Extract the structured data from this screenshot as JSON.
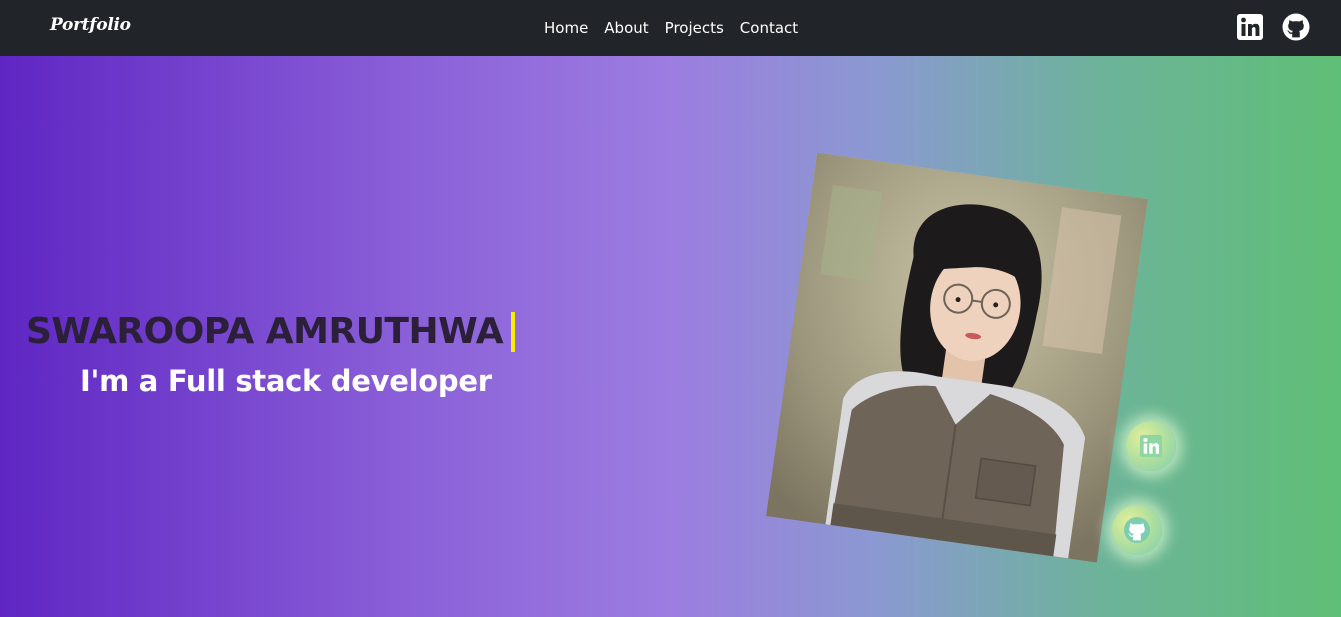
{
  "navbar": {
    "brand": "Portfolio",
    "links": [
      {
        "label": "Home"
      },
      {
        "label": "About"
      },
      {
        "label": "Projects"
      },
      {
        "label": "Contact"
      }
    ],
    "icons": [
      "linkedin-icon",
      "github-icon"
    ]
  },
  "hero": {
    "name": "SWAROOPA AMRUTHWA",
    "tagline": "I'm a Full stack developer",
    "cursor_color": "#f6f000",
    "gradient_colors": [
      "#5f26c3",
      "#9c7de0",
      "#5fbf76"
    ],
    "floating_icons": [
      "linkedin-icon",
      "github-icon"
    ]
  }
}
